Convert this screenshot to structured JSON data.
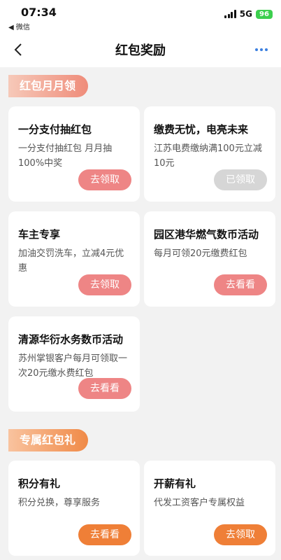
{
  "status": {
    "time": "07:34",
    "back_app": "◀ 微信",
    "network": "5G",
    "battery": "96"
  },
  "nav": {
    "title": "红包奖励"
  },
  "sections": [
    {
      "tag": "红包月月领",
      "cards": [
        {
          "title": "一分支付抽红包",
          "desc": "一分支付抽红包 月月抽100%中奖",
          "button": "去领取"
        },
        {
          "title": "缴费无忧，电亮未来",
          "desc": "江苏电费缴纳满100元立减10元",
          "button": "已领取"
        },
        {
          "title": "车主专享",
          "desc": "加油交罚洗车，立减4元优惠",
          "button": "去领取"
        },
        {
          "title": "园区港华燃气数币活动",
          "desc": "每月可领20元缴费红包",
          "button": "去看看"
        },
        {
          "title": "清源华衍水务数币活动",
          "desc": "苏州掌银客户每月可领取一次20元缴水费红包",
          "button": "去看看"
        }
      ]
    },
    {
      "tag": "专属红包礼",
      "cards": [
        {
          "title": "积分有礼",
          "desc": "积分兑换，尊享服务",
          "button": "去看看"
        },
        {
          "title": "开薪有礼",
          "desc": "代发工资客户专属权益",
          "button": "去领取"
        }
      ]
    }
  ],
  "colors": {
    "claim_button": "#ee8585",
    "claimed_button": "#d6d6d6",
    "exclusive_button": "#ef7f37",
    "more_dots": "#3b7fe0"
  }
}
